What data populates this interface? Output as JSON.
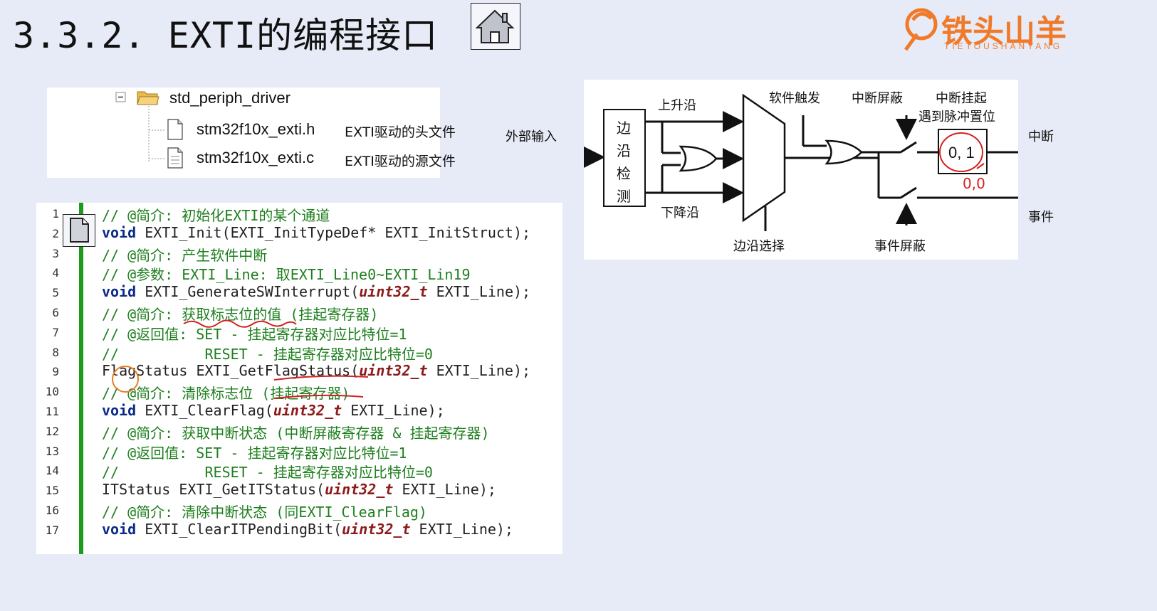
{
  "header": {
    "title": "3.3.2. EXTI的编程接口",
    "home_icon": "home-icon"
  },
  "logo": {
    "name": "铁头山羊",
    "subtitle": "TIETOUSHANYANG"
  },
  "file_tree": {
    "folder": "std_periph_driver",
    "files": [
      {
        "name": "stm32f10x_exti.h",
        "desc": "EXTI驱动的头文件"
      },
      {
        "name": "stm32f10x_exti.c",
        "desc": "EXTI驱动的源文件"
      }
    ]
  },
  "code": {
    "line_numbers": [
      "1",
      "2",
      "3",
      "4",
      "5",
      "6",
      "7",
      "8",
      "9",
      "10",
      "11",
      "12",
      "13",
      "14",
      "15",
      "16",
      "17"
    ],
    "lines": [
      [
        {
          "c": "cm",
          "t": "// @简介: 初始化EXTI的某个通道"
        }
      ],
      [
        {
          "c": "kw",
          "t": "void"
        },
        {
          "c": "pn",
          "t": " EXTI_Init(EXTI_InitTypeDef* EXTI_InitStruct);"
        }
      ],
      [
        {
          "c": "cm",
          "t": "// @简介: 产生软件中断"
        }
      ],
      [
        {
          "c": "cm",
          "t": "// @参数: EXTI_Line: 取EXTI_Line0~EXTI_Lin19"
        }
      ],
      [
        {
          "c": "kw",
          "t": "void"
        },
        {
          "c": "pn",
          "t": " EXTI_GenerateSWInterrupt("
        },
        {
          "c": "ty",
          "t": "uint32_t"
        },
        {
          "c": "pn",
          "t": " EXTI_Line);"
        }
      ],
      [
        {
          "c": "cm",
          "t": "// @简介: 获取标志位的值 (挂起寄存器)"
        }
      ],
      [
        {
          "c": "cm",
          "t": "// @返回值: SET - 挂起寄存器对应比特位=1"
        }
      ],
      [
        {
          "c": "cm",
          "t": "//          RESET - 挂起寄存器对应比特位=0"
        }
      ],
      [
        {
          "c": "pn",
          "t": "FlagStatus EXTI_GetFlagStatus("
        },
        {
          "c": "ty",
          "t": "uint32_t"
        },
        {
          "c": "pn",
          "t": " EXTI_Line);"
        }
      ],
      [
        {
          "c": "cm",
          "t": "// @简介: 清除标志位 (挂起寄存器)"
        }
      ],
      [
        {
          "c": "kw",
          "t": "void"
        },
        {
          "c": "pn",
          "t": " EXTI_ClearFlag("
        },
        {
          "c": "ty",
          "t": "uint32_t"
        },
        {
          "c": "pn",
          "t": " EXTI_Line);"
        }
      ],
      [
        {
          "c": "cm",
          "t": "// @简介: 获取中断状态 (中断屏蔽寄存器 & 挂起寄存器)"
        }
      ],
      [
        {
          "c": "cm",
          "t": "// @返回值: SET - 挂起寄存器对应比特位=1"
        }
      ],
      [
        {
          "c": "cm",
          "t": "//          RESET - 挂起寄存器对应比特位=0"
        }
      ],
      [
        {
          "c": "pn",
          "t": "ITStatus EXTI_GetITStatus("
        },
        {
          "c": "ty",
          "t": "uint32_t"
        },
        {
          "c": "pn",
          "t": " EXTI_Line);"
        }
      ],
      [
        {
          "c": "cm",
          "t": "// @简介: 清除中断状态 (同EXTI_ClearFlag)"
        }
      ],
      [
        {
          "c": "kw",
          "t": "void"
        },
        {
          "c": "pn",
          "t": " EXTI_ClearITPendingBit("
        },
        {
          "c": "ty",
          "t": "uint32_t"
        },
        {
          "c": "pn",
          "t": " EXTI_Line);"
        }
      ]
    ],
    "doc_icon": "document-icon"
  },
  "diagram": {
    "external_input": "外部输入",
    "edge_detect": [
      "边",
      "沿",
      "检",
      "测"
    ],
    "rising_edge": "上升沿",
    "falling_edge": "下降沿",
    "software_trigger": "软件触发",
    "interrupt_mask": "中断屏蔽",
    "pending": "中断挂起",
    "pending_note": "遇到脉冲置位",
    "pending_value": "0, 1",
    "edge_select": "边沿选择",
    "event_mask": "事件屏蔽",
    "interrupt": "中断",
    "event": "事件",
    "handwritten": "0,0"
  }
}
